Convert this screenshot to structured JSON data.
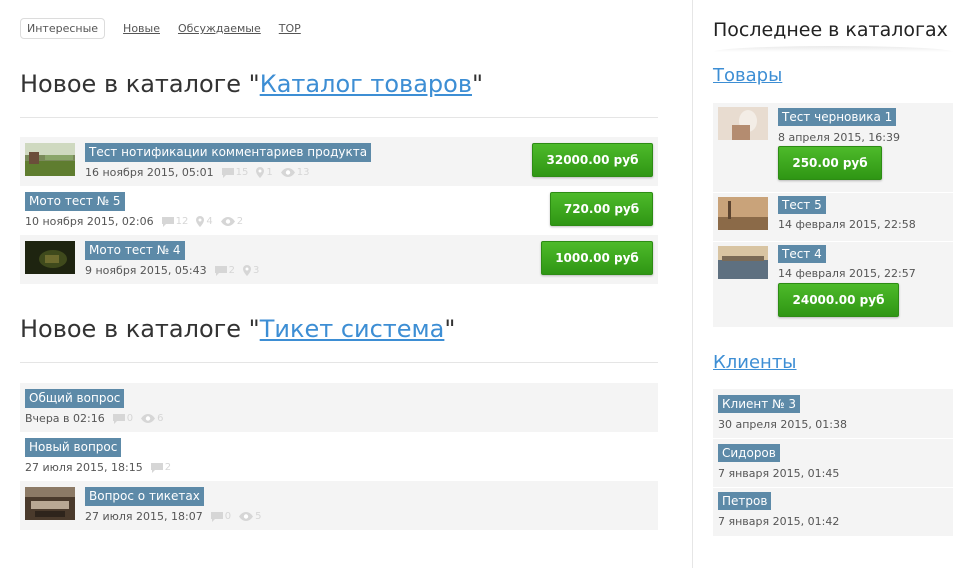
{
  "tabs": [
    {
      "label": "Интересные"
    },
    {
      "label": "Новые"
    },
    {
      "label": "Обсуждаемые"
    },
    {
      "label": "TOP"
    }
  ],
  "section1": {
    "prefix": "Новое в каталоге \"",
    "link": "Каталог товаров",
    "suffix": "\"",
    "items": [
      {
        "title": "Тест нотификации комментариев продукта",
        "date": "16 ноября 2015, 05:01",
        "comments": "15",
        "views": "1",
        "likes": "13",
        "price": "32000.00 руб"
      },
      {
        "title": "Мото тест № 5",
        "date": "10 ноября 2015, 02:06",
        "comments": "12",
        "views": "4",
        "likes": "2",
        "price": "720.00 руб"
      },
      {
        "title": "Мото тест № 4",
        "date": "9 ноября 2015, 05:43",
        "comments": "2",
        "views": "3",
        "price": "1000.00 руб"
      }
    ]
  },
  "section2": {
    "prefix": "Новое в каталоге \"",
    "link": "Тикет система",
    "suffix": "\"",
    "items": [
      {
        "title": "Общий вопрос",
        "date": "Вчера в 02:16",
        "comments": "0",
        "likes": "6"
      },
      {
        "title": "Новый вопрос",
        "date": "27 июля 2015, 18:15",
        "comments": "2"
      },
      {
        "title": "Вопрос о тикетах",
        "date": "27 июля 2015, 18:07",
        "comments": "0",
        "likes": "5"
      }
    ]
  },
  "sidebar": {
    "title": "Последнее в каталогах",
    "cat1": {
      "label": "Товары",
      "items": [
        {
          "title": "Тест черновика 1",
          "date": "8 апреля 2015, 16:39",
          "price": "250.00 руб"
        },
        {
          "title": "Тест 5",
          "date": "14 февраля 2015, 22:58"
        },
        {
          "title": "Тест 4",
          "date": "14 февраля 2015, 22:57",
          "price": "24000.00 руб"
        }
      ]
    },
    "cat2": {
      "label": "Клиенты",
      "items": [
        {
          "title": "Клиент № 3",
          "date": "30 апреля 2015, 01:38"
        },
        {
          "title": "Сидоров",
          "date": "7 января 2015, 01:45"
        },
        {
          "title": "Петров",
          "date": "7 января 2015, 01:42"
        }
      ]
    }
  },
  "colors": {
    "accent": "#3d8ed4",
    "tag": "#5d8aa8",
    "price_green": "#3aa61c"
  }
}
